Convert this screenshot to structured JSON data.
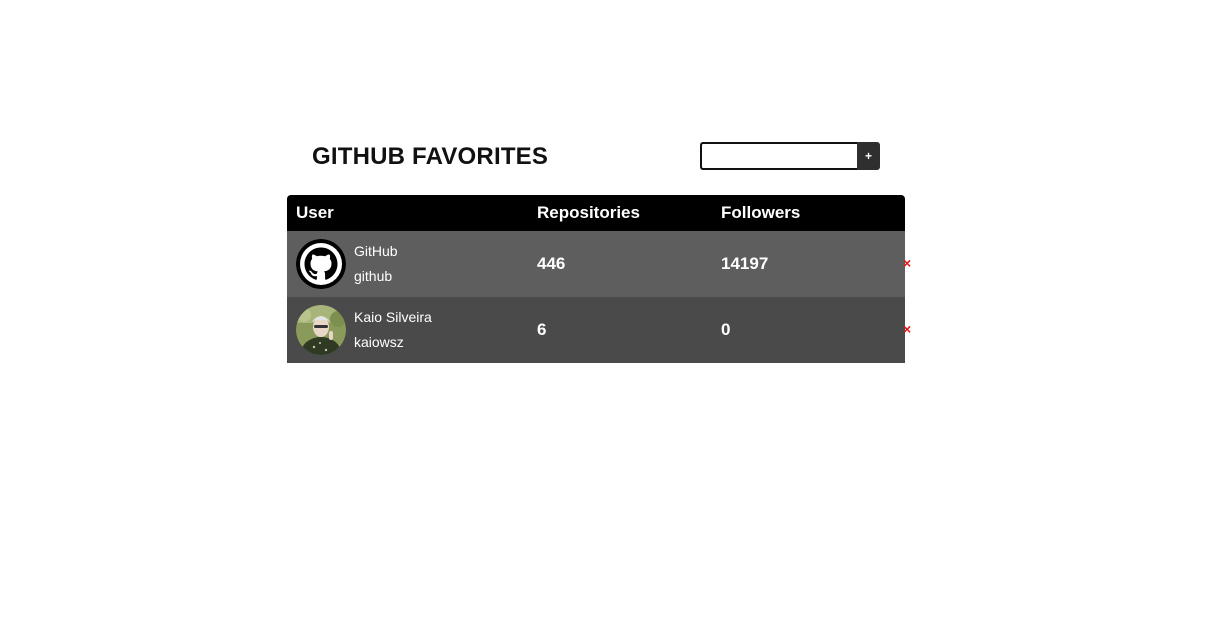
{
  "header": {
    "title": "GITHUB FAVORITES",
    "search_placeholder": "",
    "search_value": "",
    "add_label": "+"
  },
  "table": {
    "columns": [
      "User",
      "Repositories",
      "Followers",
      ""
    ],
    "rows": [
      {
        "name": "GitHub",
        "login": "github",
        "repositories": "446",
        "followers": "14197",
        "avatar_icon": "github-octocat-icon",
        "remove_label": "×"
      },
      {
        "name": "Kaio Silveira",
        "login": "kaiowsz",
        "repositories": "6",
        "followers": "0",
        "avatar_icon": "user-photo",
        "remove_label": "×"
      }
    ]
  },
  "colors": {
    "header_bg": "#000000",
    "row_1_bg": "#5e5e5e",
    "row_2_bg": "#4b4a4a",
    "remove_color": "#e0161c",
    "add_button_bg": "#2f2f2f"
  }
}
